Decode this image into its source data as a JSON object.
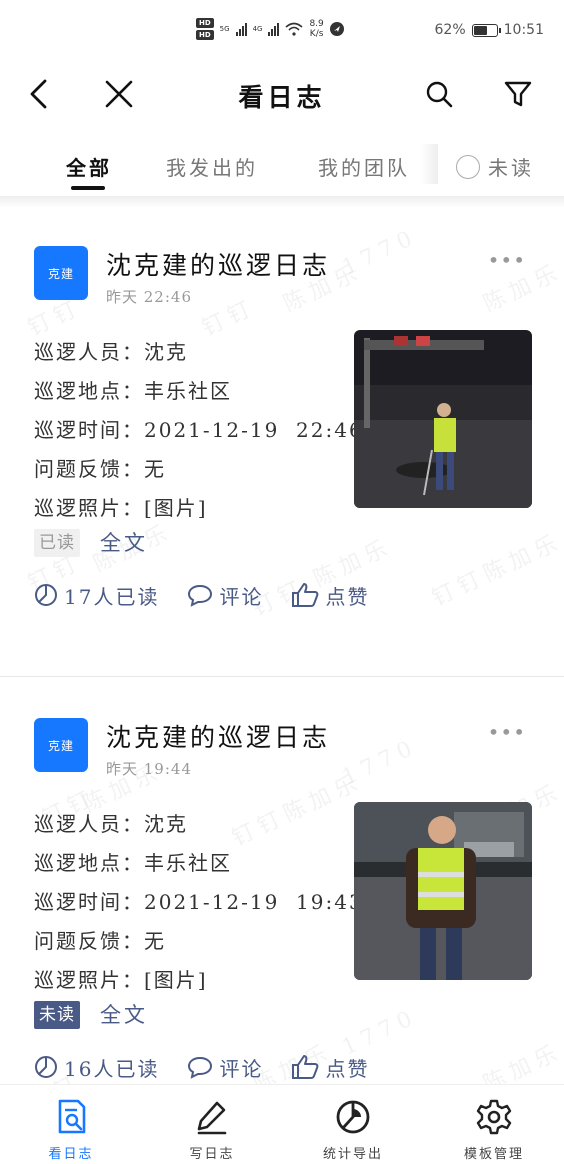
{
  "status_bar": {
    "hd_top": "HD",
    "hd_bottom": "HD",
    "net1": "5G",
    "net2": "4G",
    "speed_value": "8.9",
    "speed_unit": "K/s",
    "battery_percent": "62%",
    "battery_level": 0.62,
    "time": "10:51"
  },
  "nav": {
    "title": "看日志",
    "back_icon": "back-chevron-icon",
    "close_icon": "close-icon",
    "search_icon": "search-icon",
    "filter_icon": "filter-icon"
  },
  "tabs": {
    "all": "全部",
    "sent": "我发出的",
    "team": "我的团队",
    "unread": "未读"
  },
  "watermark": {
    "text1": "钉钉",
    "text2": "陈加乐",
    "text3": "1770"
  },
  "logs": [
    {
      "avatar_text": "克建",
      "title": "沈克建的巡逻日志",
      "time": "昨天  22:46",
      "fields": [
        "巡逻人员：沈克",
        "巡逻地点：丰乐社区",
        "巡逻时间：2021-12-19  22:46",
        "问题反馈：无",
        "巡逻照片：[图片]"
      ],
      "status": "已读",
      "fulltext": "全文",
      "read_count": "17人已读",
      "comment": "评论",
      "like": "点赞"
    },
    {
      "avatar_text": "克建",
      "title": "沈克建的巡逻日志",
      "time": "昨天  19:44",
      "fields": [
        "巡逻人员：沈克",
        "巡逻地点：丰乐社区",
        "巡逻时间：2021-12-19  19:43",
        "问题反馈：无",
        "巡逻照片：[图片]"
      ],
      "status": "未读",
      "fulltext": "全文",
      "read_count": "16人已读",
      "comment": "评论",
      "like": "点赞"
    }
  ],
  "bottom_nav": [
    {
      "label": "看日志",
      "icon": "view-log-icon",
      "active": true
    },
    {
      "label": "写日志",
      "icon": "pen-icon",
      "active": false
    },
    {
      "label": "统计导出",
      "icon": "pie-chart-icon",
      "active": false
    },
    {
      "label": "模板管理",
      "icon": "gear-icon",
      "active": false
    }
  ],
  "colors": {
    "accent": "#1677ff",
    "link": "#4a5a86",
    "unread_tag": "#4a5a86"
  }
}
